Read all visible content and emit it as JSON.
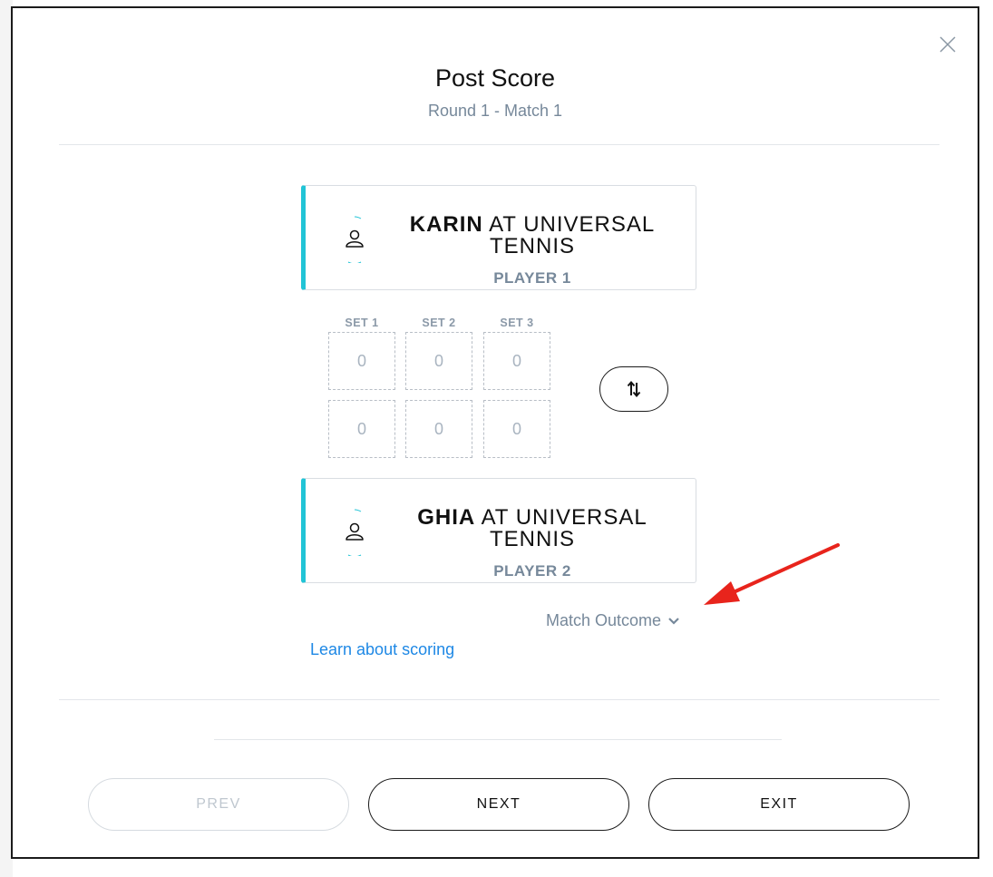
{
  "modal": {
    "title": "Post Score",
    "subtitle": "Round 1 - Match 1",
    "close_icon": "close-icon"
  },
  "players": [
    {
      "first_name": "KARIN",
      "rest_name": " AT UNIVERSAL TENNIS",
      "role": "PLAYER 1",
      "avatar_icon": "user-icon",
      "accent": "#21c4d6"
    },
    {
      "first_name": "GHIA",
      "rest_name": " AT UNIVERSAL TENNIS",
      "role": "PLAYER 2",
      "avatar_icon": "user-icon",
      "accent": "#21c4d6"
    }
  ],
  "scores": {
    "set_labels": [
      "SET 1",
      "SET 2",
      "SET 3"
    ],
    "player1": [
      "0",
      "0",
      "0"
    ],
    "player2": [
      "0",
      "0",
      "0"
    ],
    "swap_icon": "swap-vertical-icon"
  },
  "match_outcome": {
    "label": "Match Outcome",
    "icon": "chevron-down-icon"
  },
  "learn_link": "Learn about scoring",
  "annotation": {
    "icon": "red-arrow-icon",
    "color": "#e8241c"
  },
  "buttons": {
    "prev": "PREV",
    "next": "NEXT",
    "exit": "EXIT"
  }
}
